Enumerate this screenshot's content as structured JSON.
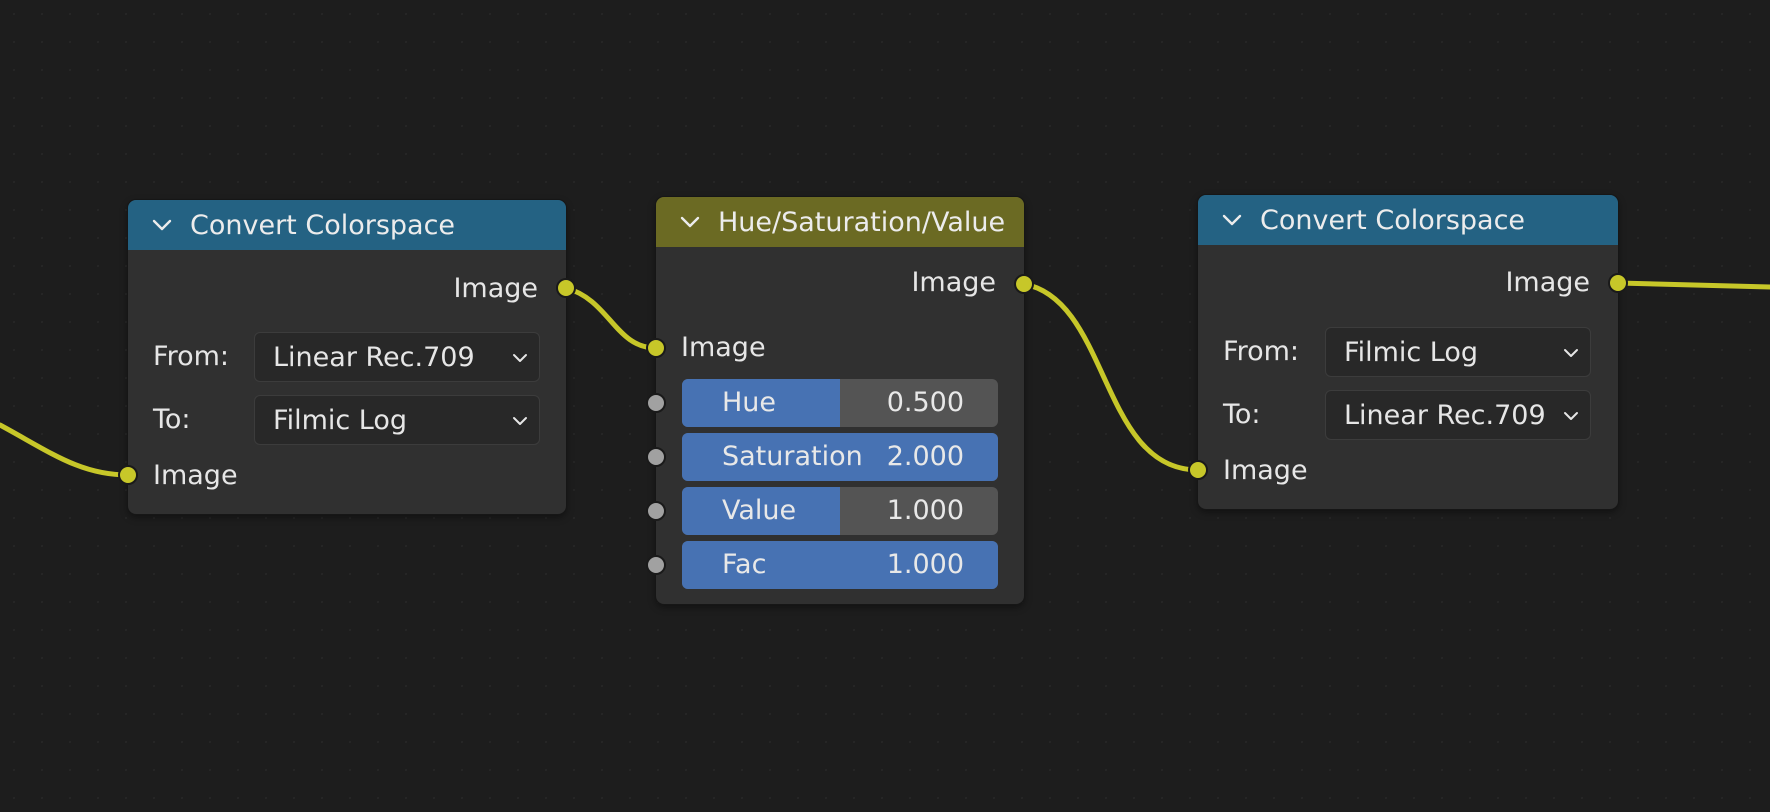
{
  "colors": {
    "background": "#1d1d1d",
    "node_body": "#303030",
    "convert_header": "#246283",
    "hsv_header": "#6b6a23",
    "link": "#c7c729",
    "socket_image": "#c7c729",
    "socket_float": "#a1a1a1",
    "slider_fill": "#4772b3",
    "slider_track": "#545454"
  },
  "nodes": {
    "convert1": {
      "title": "Convert Colorspace",
      "output_label": "Image",
      "from_label": "From:",
      "from_value": "Linear Rec.709",
      "to_label": "To:",
      "to_value": "Filmic Log",
      "input_label": "Image"
    },
    "hsv": {
      "title": "Hue/Saturation/Value",
      "output_label": "Image",
      "input_label": "Image",
      "fields": [
        {
          "label": "Hue",
          "value": "0.500",
          "fill_fraction": 0.5
        },
        {
          "label": "Saturation",
          "value": "2.000",
          "fill_fraction": 1.0
        },
        {
          "label": "Value",
          "value": "1.000",
          "fill_fraction": 0.5
        },
        {
          "label": "Fac",
          "value": "1.000",
          "fill_fraction": 1.0
        }
      ]
    },
    "convert2": {
      "title": "Convert Colorspace",
      "output_label": "Image",
      "from_label": "From:",
      "from_value": "Filmic Log",
      "to_label": "To:",
      "to_value": "Linear Rec.709",
      "input_label": "Image"
    }
  },
  "icons": {
    "collapse": "chevron-down-icon",
    "dropdown": "chevron-down-icon"
  }
}
